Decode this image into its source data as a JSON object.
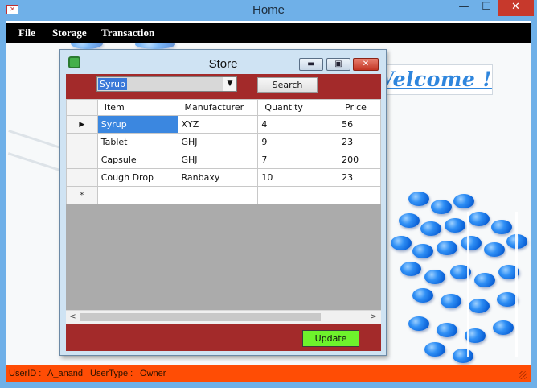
{
  "app": {
    "title": "Home",
    "icon": "app-icon",
    "window_controls": {
      "minimize": "—",
      "maximize": "☐",
      "close": "✕"
    }
  },
  "menu": {
    "items": [
      "File",
      "Storage",
      "Transaction"
    ]
  },
  "welcome": {
    "text": "Welcome !"
  },
  "store": {
    "title": "Store",
    "controls": {
      "minimize": "▬",
      "maximize": "▣",
      "close": "✕"
    },
    "search": {
      "value": "Syrup",
      "dropdown_arrow": "▼",
      "button_label": "Search"
    },
    "grid": {
      "columns": [
        "Item",
        "Manufacturer",
        "Quantity",
        "Price"
      ],
      "rows": [
        [
          "Syrup",
          "XYZ",
          "4",
          "56"
        ],
        [
          "Tablet",
          "GHJ",
          "9",
          "23"
        ],
        [
          "Capsule",
          "GHJ",
          "7",
          "200"
        ],
        [
          "Cough Drop",
          "Ranbaxy",
          "10",
          "23"
        ]
      ],
      "current_row_marker": "▶",
      "new_row_marker": "*",
      "scroll_left": "<",
      "scroll_right": ">"
    },
    "update_label": "Update"
  },
  "status": {
    "userid_label": "UserID :",
    "userid_value": "A_anand",
    "usertype_label": "UserType :",
    "usertype_value": "Owner"
  },
  "colors": {
    "titlebar": "#6fb0e8",
    "menubar": "#000000",
    "panel_red": "#a32a2a",
    "statusbar": "#ff4d05",
    "update_green": "#6ef22c",
    "welcome_blue": "#2f86dd",
    "selection_blue": "#3b87e0"
  }
}
